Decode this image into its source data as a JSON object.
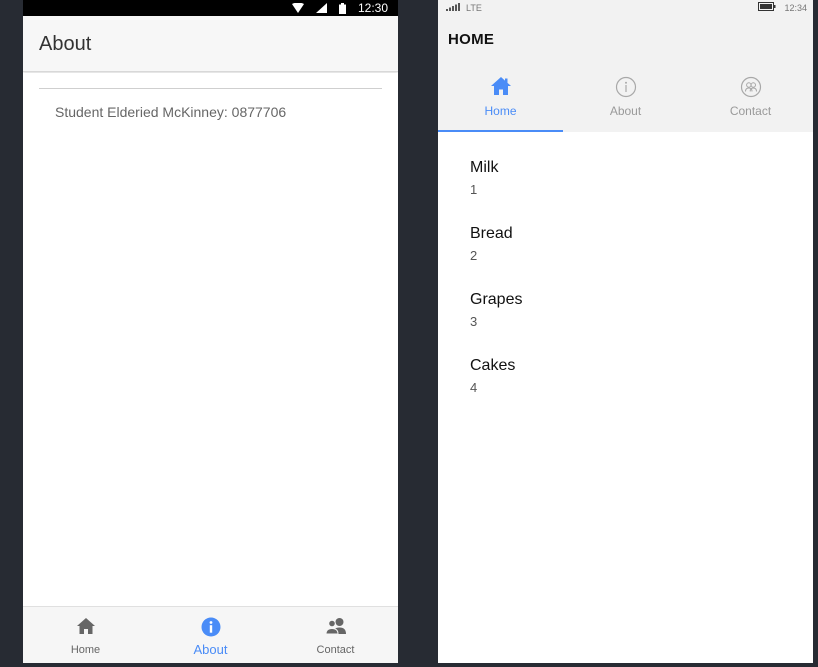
{
  "left_phone": {
    "status_bar": {
      "time": "12:30",
      "icons": [
        "wifi-icon",
        "signal-icon",
        "battery-icon"
      ]
    },
    "app_bar": {
      "title": "About"
    },
    "content": {
      "student_text": "Student Elderied McKinney: 0877706"
    },
    "tabs": [
      {
        "label": "Home",
        "icon": "home-icon",
        "active": false
      },
      {
        "label": "About",
        "icon": "info-icon",
        "active": true
      },
      {
        "label": "Contact",
        "icon": "contact-icon",
        "active": false
      }
    ],
    "colors": {
      "accent": "#4a8cf7",
      "tab_inactive": "#666666"
    }
  },
  "right_phone": {
    "status_bar": {
      "network": "LTE",
      "time": "12:34",
      "icons": [
        "signal-icon",
        "battery-icon"
      ]
    },
    "header": {
      "title": "HOME"
    },
    "pivots": [
      {
        "label": "Home",
        "icon": "home-icon",
        "active": true
      },
      {
        "label": "About",
        "icon": "info-icon",
        "active": false
      },
      {
        "label": "Contact",
        "icon": "contact-icon",
        "active": false
      }
    ],
    "items": [
      {
        "name": "Milk",
        "quantity": "1"
      },
      {
        "name": "Bread",
        "quantity": "2"
      },
      {
        "name": "Grapes",
        "quantity": "3"
      },
      {
        "name": "Cakes",
        "quantity": "4"
      }
    ],
    "colors": {
      "accent": "#4a8cf7",
      "pivot_inactive": "#9a9a9a"
    }
  }
}
